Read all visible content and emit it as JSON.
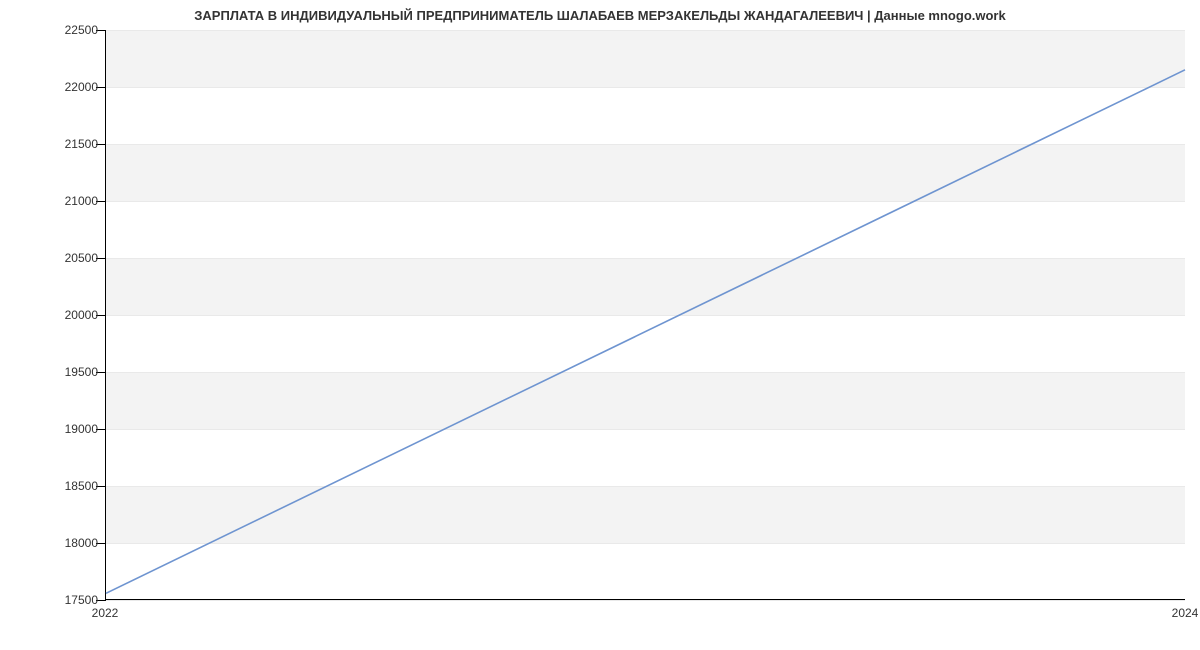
{
  "chart_data": {
    "type": "line",
    "title": "ЗАРПЛАТА В ИНДИВИДУАЛЬНЫЙ ПРЕДПРИНИМАТЕЛЬ ШАЛАБАЕВ МЕРЗАКЕЛЬДЫ ЖАНДАГАЛЕЕВИЧ | Данные mnogo.work",
    "xlabel": "",
    "ylabel": "",
    "x": [
      2022,
      2024
    ],
    "series": [
      {
        "name": "salary",
        "values": [
          17550,
          22150
        ]
      }
    ],
    "x_ticks": [
      2022,
      2024
    ],
    "y_ticks": [
      17500,
      18000,
      18500,
      19000,
      19500,
      20000,
      20500,
      21000,
      21500,
      22000,
      22500
    ],
    "xlim": [
      2022,
      2024
    ],
    "ylim": [
      17500,
      22500
    ],
    "line_color": "#6e94d0",
    "grid": true
  }
}
